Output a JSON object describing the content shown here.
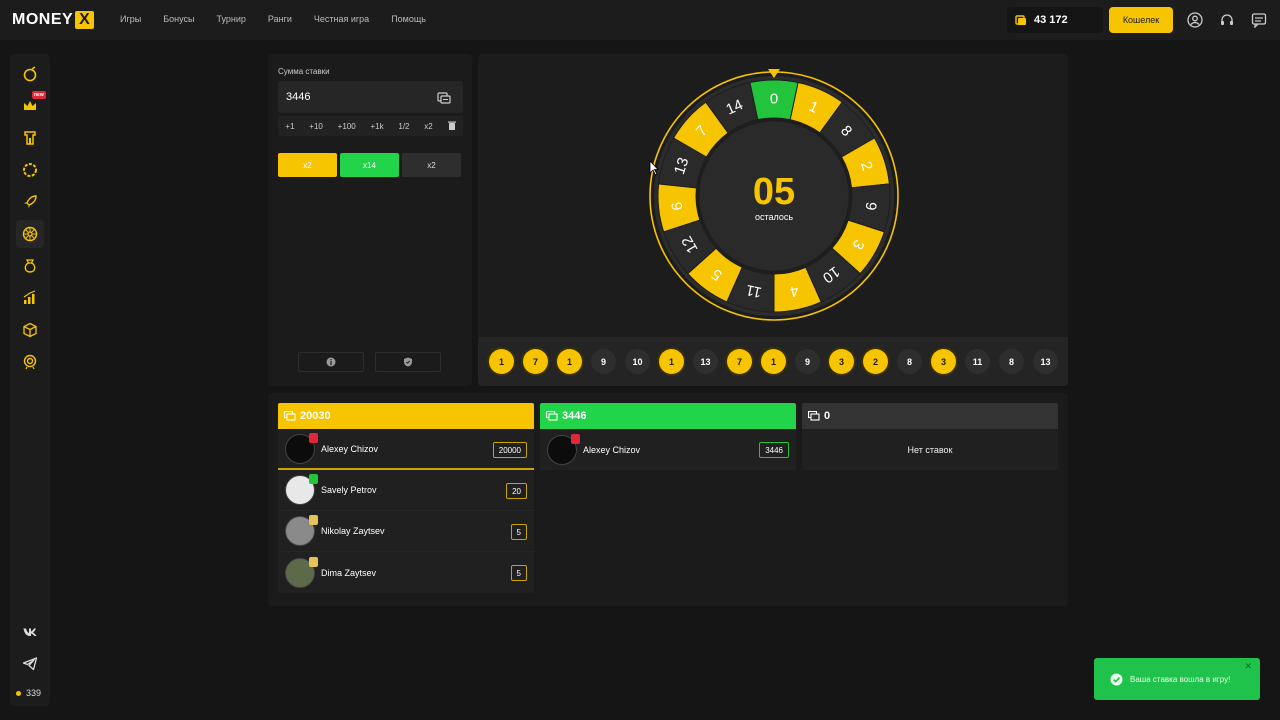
{
  "header": {
    "logo_text": "MONEY",
    "logo_mark": "X",
    "nav": [
      "Игры",
      "Бонусы",
      "Турнир",
      "Ранги",
      "Честная игра",
      "Помощь"
    ],
    "balance": "43 172",
    "wallet_label": "Кошелек",
    "icons": [
      "user-icon",
      "support-headset-icon",
      "chat-icon"
    ]
  },
  "sidebar": {
    "items": [
      "crash-icon",
      "crown-icon",
      "tower-icon",
      "ring-icon",
      "rocket-icon",
      "wheel-icon",
      "money-bag-icon",
      "chart-icon",
      "cube-icon",
      "target-icon"
    ],
    "new_badge": "new",
    "social": [
      "vk-icon",
      "telegram-icon"
    ],
    "online_count": "339"
  },
  "bet": {
    "label": "Сумма ставки",
    "amount": "3446",
    "quick": [
      "+1",
      "+10",
      "+100",
      "+1k",
      "1/2",
      "x2"
    ],
    "buttons": [
      {
        "label": "x2",
        "color": "#f7c400"
      },
      {
        "label": "x14",
        "color": "#22d44a"
      },
      {
        "label": "x2",
        "color": "#2e2e2e"
      }
    ]
  },
  "wheel": {
    "countdown": "05",
    "countdown_label": "осталось",
    "segments": [
      {
        "n": "0",
        "c": "green"
      },
      {
        "n": "1",
        "c": "yellow"
      },
      {
        "n": "8",
        "c": "dark"
      },
      {
        "n": "2",
        "c": "yellow"
      },
      {
        "n": "9",
        "c": "dark"
      },
      {
        "n": "3",
        "c": "yellow"
      },
      {
        "n": "10",
        "c": "dark"
      },
      {
        "n": "4",
        "c": "yellow"
      },
      {
        "n": "11",
        "c": "dark"
      },
      {
        "n": "5",
        "c": "yellow"
      },
      {
        "n": "12",
        "c": "dark"
      },
      {
        "n": "6",
        "c": "yellow"
      },
      {
        "n": "13",
        "c": "dark"
      },
      {
        "n": "7",
        "c": "yellow"
      },
      {
        "n": "14",
        "c": "dark"
      }
    ],
    "colors": {
      "yellow": "#f7c400",
      "dark": "#2a2a2a",
      "green": "#22c43c"
    }
  },
  "history": [
    {
      "n": "1",
      "c": "y"
    },
    {
      "n": "7",
      "c": "y"
    },
    {
      "n": "1",
      "c": "y"
    },
    {
      "n": "9",
      "c": "d"
    },
    {
      "n": "10",
      "c": "d"
    },
    {
      "n": "1",
      "c": "y"
    },
    {
      "n": "13",
      "c": "d"
    },
    {
      "n": "7",
      "c": "y"
    },
    {
      "n": "1",
      "c": "y"
    },
    {
      "n": "9",
      "c": "d"
    },
    {
      "n": "3",
      "c": "y"
    },
    {
      "n": "2",
      "c": "y"
    },
    {
      "n": "8",
      "c": "d"
    },
    {
      "n": "3",
      "c": "y"
    },
    {
      "n": "11",
      "c": "d"
    },
    {
      "n": "8",
      "c": "d"
    },
    {
      "n": "13",
      "c": "d"
    }
  ],
  "bets": {
    "columns": [
      {
        "total": "20030",
        "color": "#f7c400",
        "text_color": "#ffffff",
        "players": [
          {
            "name": "Alexey Chizov",
            "amount": "20000",
            "rank_color": "#e0283c"
          },
          {
            "name": "Savely Petrov",
            "amount": "20",
            "rank_color": "#22c43c"
          },
          {
            "name": "Nikolay Zaytsev",
            "amount": "5",
            "rank_color": "#e6c25a"
          },
          {
            "name": "Dima Zaytsev",
            "amount": "5",
            "rank_color": "#e6c25a"
          }
        ]
      },
      {
        "total": "3446",
        "color": "#22d44a",
        "text_color": "#ffffff",
        "players": [
          {
            "name": "Alexey Chizov",
            "amount": "3446",
            "rank_color": "#e0283c"
          }
        ]
      },
      {
        "total": "0",
        "color": "#333333",
        "text_color": "#ffffff",
        "players": [],
        "empty_label": "Нет ставок"
      }
    ]
  },
  "toast": {
    "message": "Ваша ставка вошла в игру!"
  }
}
